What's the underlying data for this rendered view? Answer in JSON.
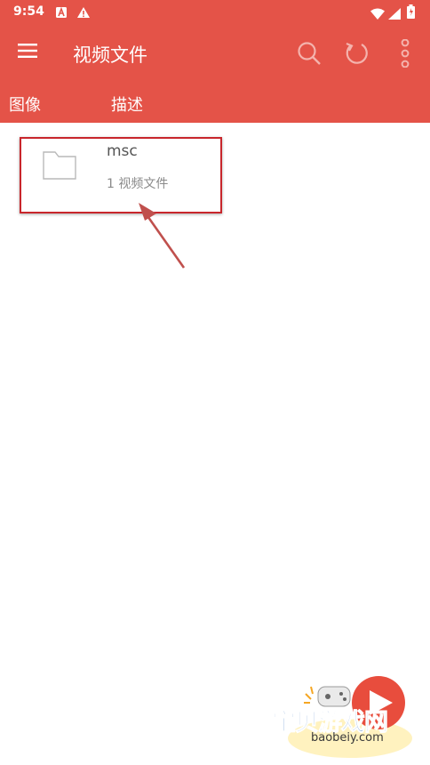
{
  "status_bar": {
    "time": "9:54",
    "left_icons": [
      "a-badge-icon",
      "warning-icon"
    ],
    "right_icons": [
      "wifi-icon",
      "signal-icon",
      "battery-icon"
    ]
  },
  "app_bar": {
    "title": "视频文件",
    "actions": [
      "search-icon",
      "refresh-icon",
      "more-vert-icon"
    ]
  },
  "tabs": [
    {
      "label": "图像"
    },
    {
      "label": "描述"
    }
  ],
  "list": [
    {
      "name": "msc",
      "subtitle": "1 视频文件",
      "icon": "folder-icon"
    }
  ],
  "watermark": {
    "text": "宝贝游戏网",
    "url": "baobeiy.com"
  },
  "colors": {
    "primary": "#e45348",
    "highlight_border": "#c8262c",
    "arrow": "#c0504d"
  }
}
